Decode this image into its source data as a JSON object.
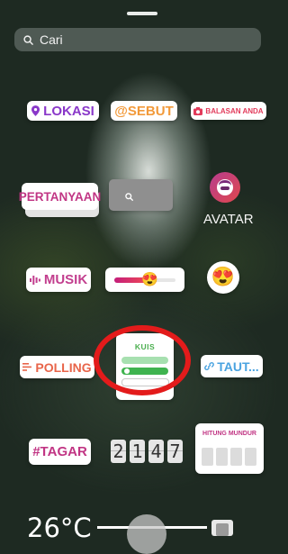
{
  "search": {
    "placeholder": "Cari"
  },
  "stickers": {
    "lokasi": "LOKASI",
    "sebut": "@SEBUT",
    "balasan": "BALASAN ANDA",
    "pertanyaan": "PERTANYAAN",
    "avatar": "AVATAR",
    "musik": "MUSIK",
    "emoji_slider": "😍",
    "emoji_reaction": "😍",
    "polling": "POLLING",
    "kuis": "KUIS",
    "tautan": "TAUT...",
    "tagar": "#TAGAR",
    "countdown_digits": [
      "2",
      "1",
      "4",
      "7"
    ],
    "hitung_mundur": "HITUNG MUNDUR",
    "temperature": "26°C"
  },
  "colors": {
    "highlight": "#e31b1b",
    "lokasi": "#8a38c9",
    "sebut": "#f29a3a",
    "kuis_green": "#3fb34f"
  },
  "icons": [
    "search-icon",
    "location-pin-icon",
    "camera-icon",
    "avatar-face-icon",
    "music-bars-icon",
    "poll-lines-icon",
    "link-icon"
  ]
}
